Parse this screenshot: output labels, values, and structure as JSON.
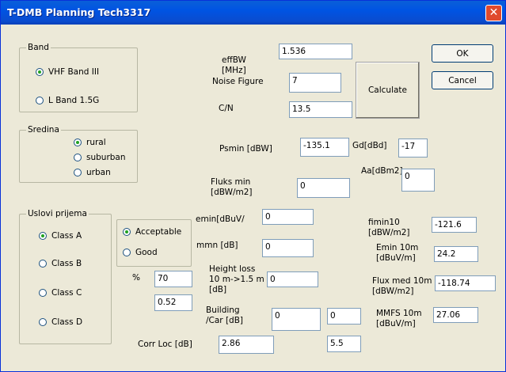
{
  "window": {
    "title": "T-DMB Planning Tech3317",
    "close_icon": "close-icon"
  },
  "band": {
    "caption": "Band",
    "options": [
      "VHF Band III",
      "L Band 1.5G"
    ],
    "selected": 0
  },
  "sredina": {
    "caption": "Sredina",
    "options": [
      "rural",
      "suburban",
      "urban"
    ],
    "selected": 0
  },
  "uslovi": {
    "caption": "Uslovi prijema",
    "options": [
      "Class A",
      "Class B",
      "Class C",
      "Class D"
    ],
    "selected": 0
  },
  "quality": {
    "options": [
      "Acceptable",
      "Good"
    ],
    "selected": 0
  },
  "labels": {
    "effbw": "effBW\n[MHz]",
    "noise_figure": "Noise Figure",
    "cn": "C/N",
    "psmin": "Psmin [dBW]",
    "gd": "Gd[dBd]",
    "fluks_min": "Fluks min\n[dBW/m2]",
    "aa": "Aa[dBm2]",
    "emin_dbuv": "emin[dBuV/",
    "mmn": "mmn [dB]",
    "height_loss": "Height loss\n10 m->1.5 m\n[dB]",
    "building": "Building\n/Car [dB]",
    "percent": "%",
    "corr_loc": "Corr Loc [dB]",
    "fimin10": "fimin10\n[dBW/m2]",
    "emin10": "Emin 10m\n[dBuV/m]",
    "fluxmed10": "Flux med 10m\n[dBW/m2]",
    "mmfs10": "MMFS 10m\n[dBuV/m]"
  },
  "values": {
    "effbw": "1.536",
    "noise_figure": "7",
    "cn": "13.5",
    "psmin": "-135.1",
    "gd": "-17",
    "fluks_min": "0",
    "aa": "0",
    "emin_dbuv": "0",
    "mmn": "0",
    "height_loss": "0",
    "building_a": "0",
    "building_b": "0",
    "percent": "70",
    "percent_factor": "0.52",
    "corr_loc": "2.86",
    "corr_loc_b": "5.5",
    "fimin10": "-121.6",
    "emin10": "24.2",
    "fluxmed10": "-118.74",
    "mmfs10": "27.06"
  },
  "buttons": {
    "ok": "OK",
    "cancel": "Cancel",
    "calculate": "Calculate"
  }
}
